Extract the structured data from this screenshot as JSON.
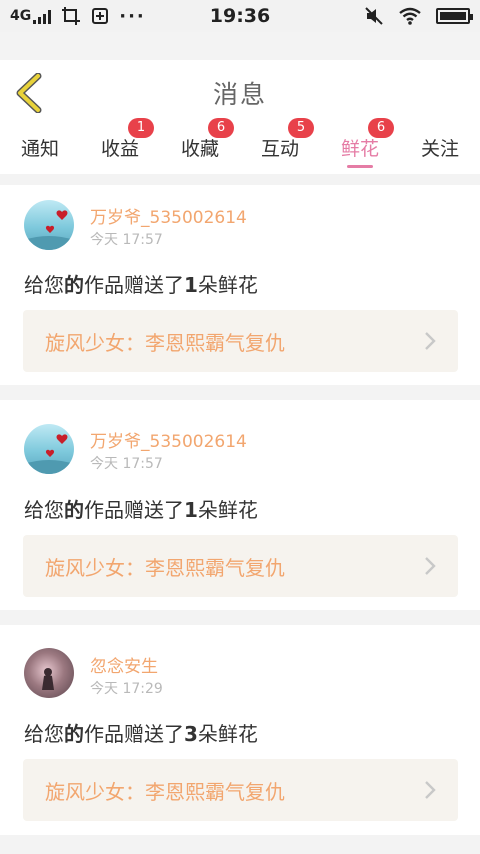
{
  "status_bar": {
    "network": "4G",
    "time": "19:36",
    "more": "···"
  },
  "header": {
    "title": "消息"
  },
  "tabs": [
    {
      "label": "通知",
      "badge": ""
    },
    {
      "label": "收益",
      "badge": "1"
    },
    {
      "label": "收藏",
      "badge": "6"
    },
    {
      "label": "互动",
      "badge": "5"
    },
    {
      "label": "鲜花",
      "badge": "6",
      "active": true
    },
    {
      "label": "关注",
      "badge": ""
    }
  ],
  "notifications": [
    {
      "username": "万岁爷_535002614",
      "time": "今天 17:57",
      "message_prefix": "给您",
      "message_de": "的",
      "message_mid": "作品赠送了",
      "count": "1",
      "message_suffix": "朵鲜花",
      "work_title": "旋风少女：李恩熙霸气复仇",
      "avatar": "hearts-avatar"
    },
    {
      "username": "万岁爷_535002614",
      "time": "今天 17:57",
      "message_prefix": "给您",
      "message_de": "的",
      "message_mid": "作品赠送了",
      "count": "1",
      "message_suffix": "朵鲜花",
      "work_title": "旋风少女：李恩熙霸气复仇",
      "avatar": "hearts-avatar"
    },
    {
      "username": "忽念安生",
      "time": "今天 17:29",
      "message_prefix": "给您",
      "message_de": "的",
      "message_mid": "作品赠送了",
      "count": "3",
      "message_suffix": "朵鲜花",
      "work_title": "旋风少女：李恩熙霸气复仇",
      "avatar": "person-avatar"
    }
  ],
  "colors": {
    "accent_pink": "#e57ca5",
    "badge_red": "#e8414a",
    "username_orange": "#f2a66f",
    "back_arrow": "#e8d23a"
  }
}
